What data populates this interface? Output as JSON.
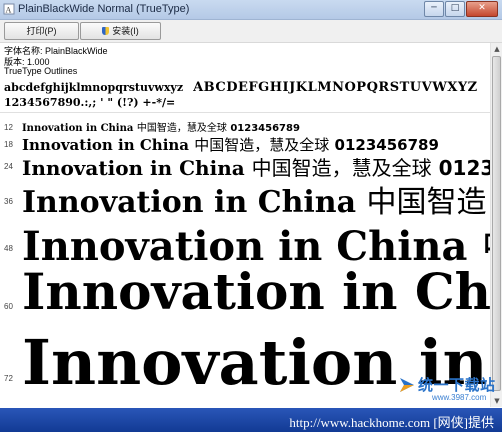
{
  "window": {
    "title": "PlainBlackWide Normal (TrueType)"
  },
  "controls": {
    "minimize": "─",
    "maximize": "□",
    "close": "✕"
  },
  "toolbar": {
    "print_label": "打印(P)",
    "install_label": "安装(I)"
  },
  "font_info": {
    "name_line": "字体名称: PlainBlackWide",
    "version_line": "版本: 1.000",
    "type_line": "TrueType Outlines"
  },
  "charset": {
    "lowercase": "abcdefghijklmnopqrstuvwxyz",
    "uppercase": "ABCDEFGHIJKLMNOPQRSTUVWXYZ",
    "digits_symbols": "1234567890.:,; ' \" (!?) +-*/="
  },
  "samples": {
    "latin": "Innovation in China",
    "cjk": "中国智造，慧及全球",
    "digits": "0123456789"
  },
  "sizes": [
    "12",
    "18",
    "24",
    "36",
    "48",
    "60",
    "72"
  ],
  "watermark": {
    "brand": "统一下载站",
    "url": "www.3987.com"
  },
  "bottom_bar": {
    "text": "http://www.hackhome.com [网侠]提供"
  },
  "colors": {
    "titlebar": "#c9daf0",
    "bottombar": "#1a44a0",
    "watermark": "#2a73c9"
  }
}
